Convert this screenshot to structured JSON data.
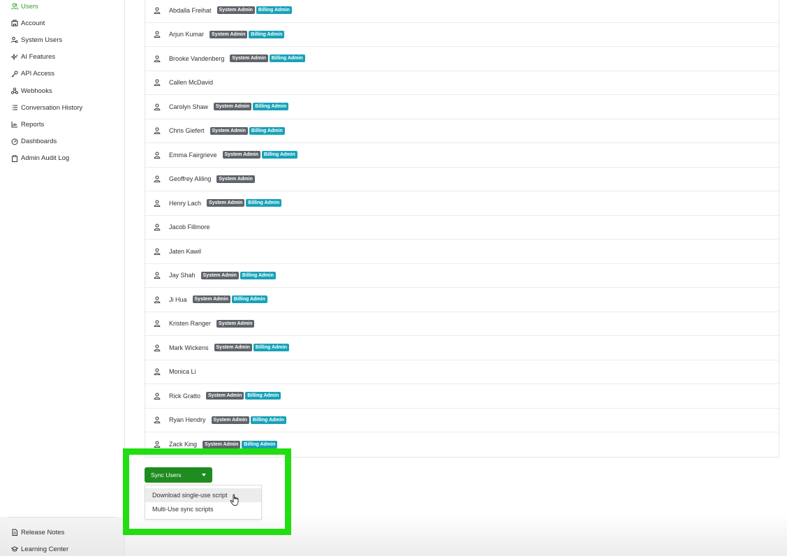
{
  "sidebar": {
    "items": [
      {
        "label": "Users",
        "icon": "users-icon",
        "active": true
      },
      {
        "label": "Account",
        "icon": "building-icon",
        "active": false
      },
      {
        "label": "System Users",
        "icon": "users-gear-icon",
        "active": false
      },
      {
        "label": "AI Features",
        "icon": "sparkles-icon",
        "active": false
      },
      {
        "label": "API Access",
        "icon": "key-icon",
        "active": false
      },
      {
        "label": "Webhooks",
        "icon": "webhook-icon",
        "active": false
      },
      {
        "label": "Conversation History",
        "icon": "list-icon",
        "active": false
      },
      {
        "label": "Reports",
        "icon": "chart-icon",
        "active": false
      },
      {
        "label": "Dashboards",
        "icon": "gauge-icon",
        "active": false
      },
      {
        "label": "Admin Audit Log",
        "icon": "clipboard-icon",
        "active": false
      }
    ],
    "bottom_items": [
      {
        "label": "Release Notes",
        "icon": "document-icon"
      },
      {
        "label": "Learning Center",
        "icon": "graduation-cap-icon"
      }
    ]
  },
  "badges": {
    "system_admin": "System Admin",
    "billing_admin": "Billing Admin"
  },
  "users": [
    {
      "name": "Abdalla Freihat",
      "roles": [
        "system_admin",
        "billing_admin"
      ]
    },
    {
      "name": "Arjun Kumar",
      "roles": [
        "system_admin",
        "billing_admin"
      ]
    },
    {
      "name": "Brooke Vandenberg",
      "roles": [
        "system_admin",
        "billing_admin"
      ]
    },
    {
      "name": "Callen McDavid",
      "roles": []
    },
    {
      "name": "Carolyn Shaw",
      "roles": [
        "system_admin",
        "billing_admin"
      ]
    },
    {
      "name": "Chris Giefert",
      "roles": [
        "system_admin",
        "billing_admin"
      ]
    },
    {
      "name": "Emma Fairgrieve",
      "roles": [
        "system_admin",
        "billing_admin"
      ]
    },
    {
      "name": "Geoffrey Aliling",
      "roles": [
        "system_admin"
      ]
    },
    {
      "name": "Henry Lach",
      "roles": [
        "system_admin",
        "billing_admin"
      ]
    },
    {
      "name": "Jacob Fillmore",
      "roles": []
    },
    {
      "name": "Jaten Kawil",
      "roles": []
    },
    {
      "name": "Jay Shah",
      "roles": [
        "system_admin",
        "billing_admin"
      ]
    },
    {
      "name": "Ji Hua",
      "roles": [
        "system_admin",
        "billing_admin"
      ]
    },
    {
      "name": "Kristen Ranger",
      "roles": [
        "system_admin"
      ]
    },
    {
      "name": "Mark Wickens",
      "roles": [
        "system_admin",
        "billing_admin"
      ]
    },
    {
      "name": "Monica Li",
      "roles": []
    },
    {
      "name": "Rick Gratto",
      "roles": [
        "system_admin",
        "billing_admin"
      ]
    },
    {
      "name": "Ryan Hendry",
      "roles": [
        "system_admin",
        "billing_admin"
      ]
    },
    {
      "name": "Zack King",
      "roles": [
        "system_admin",
        "billing_admin"
      ]
    }
  ],
  "sync": {
    "button_label": "Sync Users",
    "menu": [
      {
        "label": "Download single-use script",
        "hovered": true
      },
      {
        "label": "Multi-Use sync scripts",
        "hovered": false
      }
    ]
  },
  "colors": {
    "active_nav": "#2f9e2f",
    "system_admin_badge": "#5f646a",
    "billing_admin_badge": "#17a2b8",
    "sync_button": "#1e8c1e",
    "highlight_box": "#22dd11"
  }
}
